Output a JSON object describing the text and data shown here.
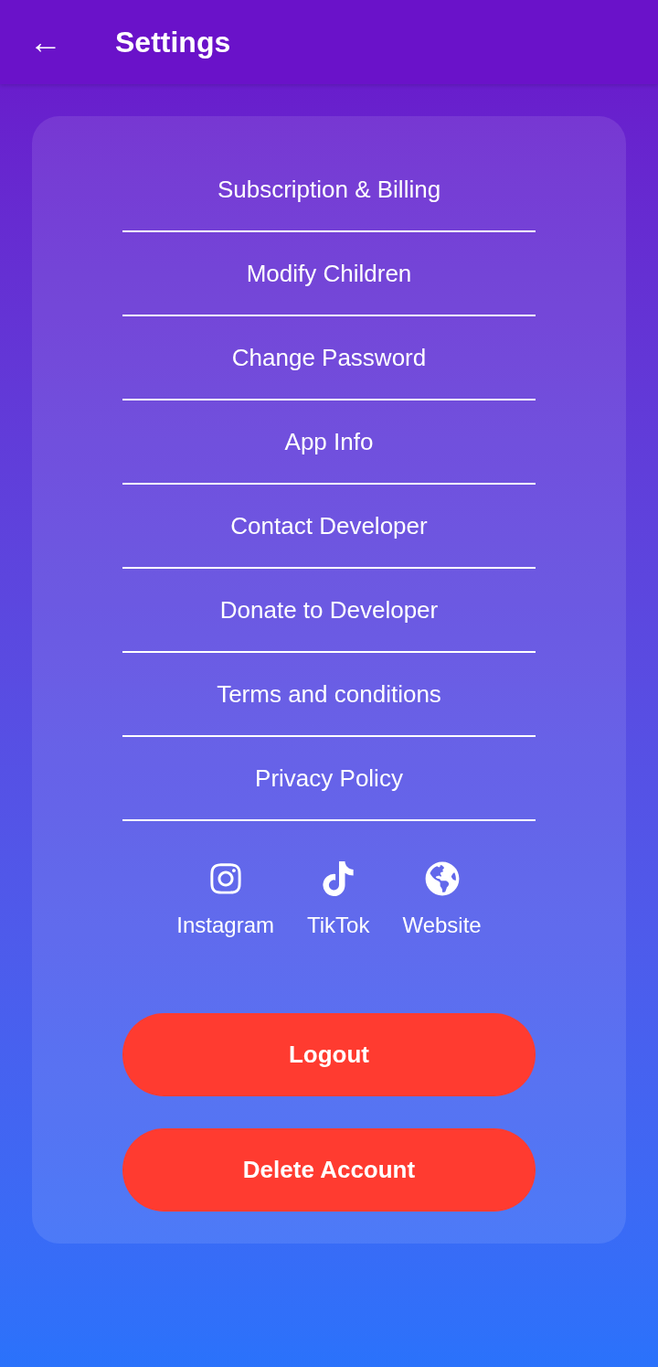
{
  "header": {
    "back_icon": "←",
    "title": "Settings"
  },
  "menu": [
    {
      "label": "Subscription & Billing"
    },
    {
      "label": "Modify Children"
    },
    {
      "label": "Change Password"
    },
    {
      "label": "App Info"
    },
    {
      "label": "Contact Developer"
    },
    {
      "label": "Donate to Developer"
    },
    {
      "label": "Terms and conditions"
    },
    {
      "label": "Privacy Policy"
    }
  ],
  "social_links": [
    {
      "kind": "instagram",
      "label": "Instagram"
    },
    {
      "kind": "tiktok",
      "label": "TikTok"
    },
    {
      "kind": "website",
      "label": "Website"
    }
  ],
  "buttons": [
    {
      "label": "Logout"
    },
    {
      "label": "Delete Account"
    }
  ]
}
